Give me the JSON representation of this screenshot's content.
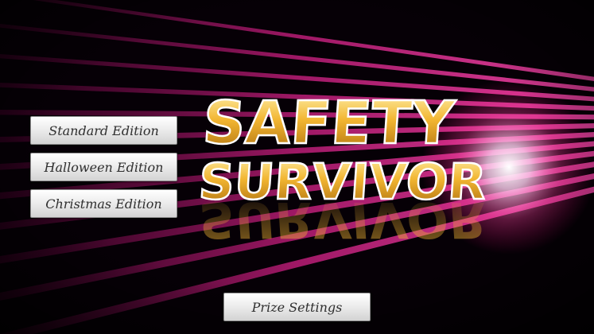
{
  "menu": {
    "standard_label": "Standard Edition",
    "halloween_label": "Halloween Edition",
    "christmas_label": "Christmas Edition"
  },
  "footer": {
    "prize_label": "Prize Settings"
  },
  "logo": {
    "line1": "SAFETY",
    "line2": "SURVIVOR"
  },
  "colors": {
    "background": "#000000",
    "stripe_magenta": "#c0207a",
    "logo_gold": "#f0b830",
    "button_face": "#e6e6e6"
  }
}
